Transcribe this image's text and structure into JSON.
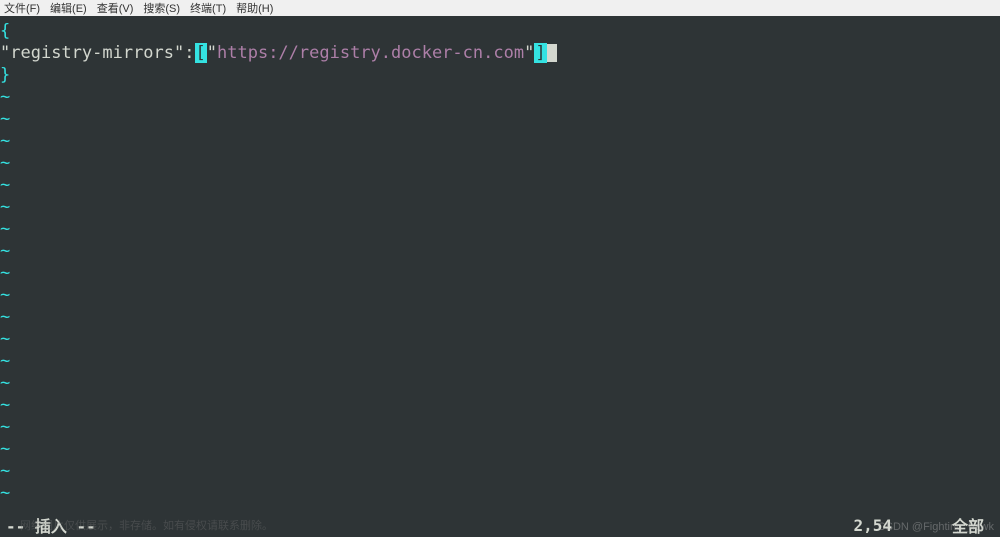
{
  "menubar": {
    "items": [
      "文件(F)",
      "编辑(E)",
      "查看(V)",
      "搜索(S)",
      "终端(T)",
      "帮助(H)"
    ]
  },
  "content": {
    "line1_brace": "{",
    "line2_quote1": "\"",
    "line2_key": "registry-mirrors",
    "line2_quote2": "\"",
    "line2_colon": ":",
    "line2_bracket_open": "[",
    "line2_quote3": "\"",
    "line2_url": "https://registry.docker-cn.com",
    "line2_quote4": "\"",
    "line2_bracket_close": "]",
    "line3_brace": "}",
    "tilde": "~"
  },
  "status": {
    "mode": "-- 插入 --",
    "position": "2,54",
    "percent": "全部"
  },
  "watermark": "CSDN @Fighting_hawk",
  "watermark2": "网络图片仅供展示，非存储。如有侵权请联系删除。"
}
